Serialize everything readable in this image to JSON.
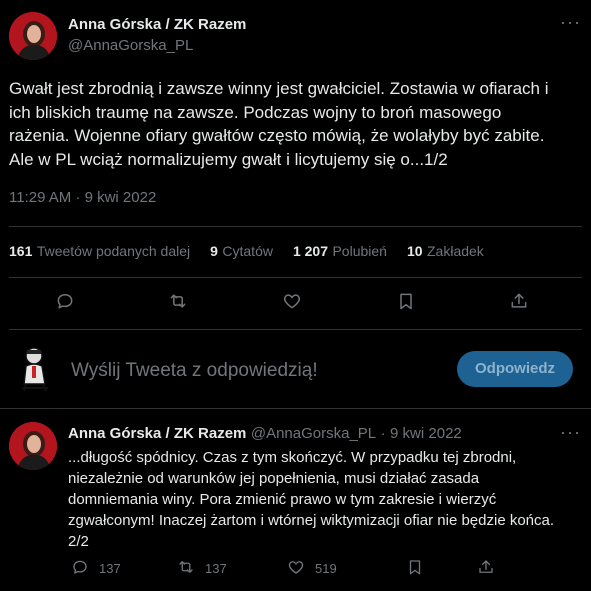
{
  "colors": {
    "background": "#000000",
    "text": "#e7e9ea",
    "muted": "#71767b",
    "divider": "#2f3336",
    "reply_button": "#1d6292"
  },
  "tweet": {
    "author_name": "Anna Górska / ZK Razem",
    "author_handle": "@AnnaGorska_PL",
    "more_icon": "more-icon",
    "text": "Gwałt jest zbrodnią i zawsze winny jest gwałciciel. Zostawia w ofiarach i\nich bliskich traumę na zawsze. Podczas wojny to broń masowego\nrażenia. Wojenne ofiary gwałtów często mówią, że wolałyby być zabite.\nAle w PL wciąż normalizujemy gwałt i licytujemy się o...1/2",
    "timestamp": "11:29 AM · 9 kwi 2022",
    "stats": {
      "retweets_count": "161",
      "retweets_label": "Tweetów podanych dalej",
      "quotes_count": "9",
      "quotes_label": "Cytatów",
      "likes_count": "1 207",
      "likes_label": "Polubień",
      "bookmarks_count": "10",
      "bookmarks_label": "Zakładek"
    },
    "actions": [
      "reply-icon",
      "retweet-icon",
      "like-icon",
      "bookmark-icon",
      "share-icon"
    ]
  },
  "compose": {
    "placeholder": "Wyślij Tweeta z odpowiedzią!",
    "button_label": "Odpowiedz"
  },
  "reply": {
    "author_name": "Anna Górska / ZK Razem",
    "author_handle": "@AnnaGorska_PL",
    "separator": "·",
    "date": "9 kwi 2022",
    "text": "...długość spódnicy. Czas z tym skończyć. W przypadku tej zbrodni,\nniezależnie od warunków jej popełnienia, musi działać zasada\ndomniemania winy. Pora zmienić prawo w tym zakresie i wierzyć\nzgwałconym! Inaczej żartom i wtórnej wiktymizacji ofiar nie będzie końca.\n2/2",
    "reply_count": "137",
    "retweet_count": "137",
    "like_count": "519"
  }
}
